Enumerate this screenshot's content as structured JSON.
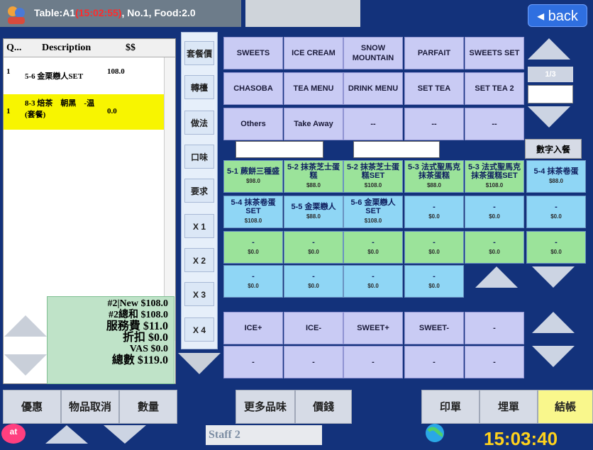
{
  "header": {
    "table_label": "Table:A1",
    "time": "(15:02:55)",
    "rest": ", No.1, Food:2.0",
    "back": "◂ back"
  },
  "order": {
    "cols": [
      "Q...",
      "Description",
      "$$"
    ],
    "rows": [
      {
        "q": "1",
        "desc": "5-6 金栗戀人SET",
        "price": "108.0"
      },
      {
        "q": "1",
        "desc": "8-3 焙茶　朝黑　-温 (套餐)",
        "price": "0.0"
      }
    ],
    "summary": [
      "#2|New $108.0",
      "#2總和 $108.0",
      "服務費 $11.0",
      "折扣 $0.0",
      "VAS $0.0",
      "總數 $119.0"
    ]
  },
  "side_buttons": [
    "套餐價",
    "轉檯",
    "做法",
    "口味",
    "要求",
    "X 1",
    "X 2",
    "X 3",
    "X 4"
  ],
  "categories": [
    [
      "SWEETS",
      "ICE CREAM",
      "SNOW MOUNTAIN",
      "PARFAIT",
      "SWEETS SET"
    ],
    [
      "CHASOBA",
      "TEA MENU",
      "DRINK MENU",
      "SET TEA",
      "SET TEA 2"
    ],
    [
      "Others",
      "Take Away",
      "--",
      "--",
      "--"
    ]
  ],
  "page_indicator": "1/3",
  "num_button": "數字入餐",
  "items_row1": [
    {
      "name": "5-1 蕨餅三種盛",
      "price": "$98.0"
    },
    {
      "name": "5-2 抹茶芝士蛋糕",
      "price": "$88.0"
    },
    {
      "name": "5-2 抹茶芝士蛋糕SET",
      "price": "$108.0"
    },
    {
      "name": "5-3 法式聖馬克抹茶蛋糕",
      "price": "$88.0"
    },
    {
      "name": "5-3 法式聖馬克抹茶蛋糕SET",
      "price": "$108.0"
    },
    {
      "name": "5-4 抹茶卷蛋",
      "price": "$88.0"
    }
  ],
  "items_row2": [
    {
      "name": "5-4 抹茶卷蛋SET",
      "price": "$108.0"
    },
    {
      "name": "5-5 金栗戀人",
      "price": "$88.0"
    },
    {
      "name": "5-6 金栗戀人SET",
      "price": "$108.0"
    },
    {
      "name": "-",
      "price": "$0.0"
    },
    {
      "name": "-",
      "price": "$0.0"
    },
    {
      "name": "-",
      "price": "$0.0"
    }
  ],
  "items_row3": [
    {
      "name": "-",
      "price": "$0.0"
    },
    {
      "name": "-",
      "price": "$0.0"
    },
    {
      "name": "-",
      "price": "$0.0"
    },
    {
      "name": "-",
      "price": "$0.0"
    },
    {
      "name": "-",
      "price": "$0.0"
    },
    {
      "name": "-",
      "price": "$0.0"
    }
  ],
  "items_row4": [
    {
      "name": "-",
      "price": "$0.0"
    },
    {
      "name": "-",
      "price": "$0.0"
    },
    {
      "name": "-",
      "price": "$0.0"
    },
    {
      "name": "-",
      "price": "$0.0"
    }
  ],
  "modifiers": [
    [
      "ICE+",
      "ICE-",
      "SWEET+",
      "SWEET-",
      "-"
    ],
    [
      "-",
      "-",
      "-",
      "-",
      "-"
    ]
  ],
  "bottom": {
    "discount": "優惠",
    "cancel": "物品取消",
    "qty": "數量",
    "more": "更多品味",
    "price": "價錢",
    "print": "印單",
    "bill": "埋單",
    "checkout": "結帳",
    "staff": "Staff 2",
    "clock": "15:03:40",
    "logo": "at"
  }
}
